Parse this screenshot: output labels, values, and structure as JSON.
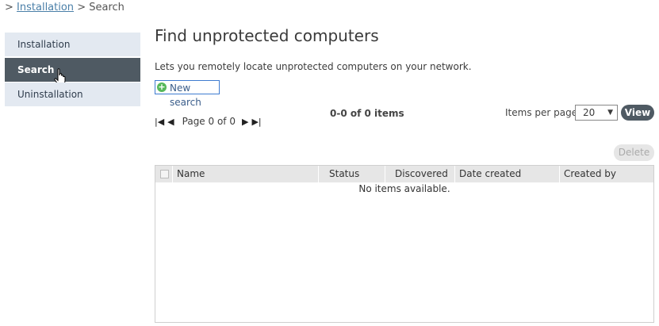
{
  "breadcrumb": {
    "prefix": ">",
    "link": "Installation",
    "separator": ">",
    "current": "Search"
  },
  "sidebar": {
    "items": [
      {
        "label": "Installation"
      },
      {
        "label": "Search"
      },
      {
        "label": "Uninstallation"
      }
    ]
  },
  "page": {
    "title": "Find unprotected computers",
    "description": "Lets you remotely locate unprotected computers on your network.",
    "new_search_label": "New search"
  },
  "pager": {
    "page_label": "Page 0 of 0",
    "count_label": "0-0 of 0 items",
    "items_per_page_label": "Items per page",
    "items_per_page_value": "20",
    "view_label": "View"
  },
  "actions": {
    "delete_label": "Delete"
  },
  "grid": {
    "columns": [
      "Name",
      "Status",
      "Discovered",
      "Date created",
      "Created by"
    ],
    "empty_message": "No items available."
  }
}
